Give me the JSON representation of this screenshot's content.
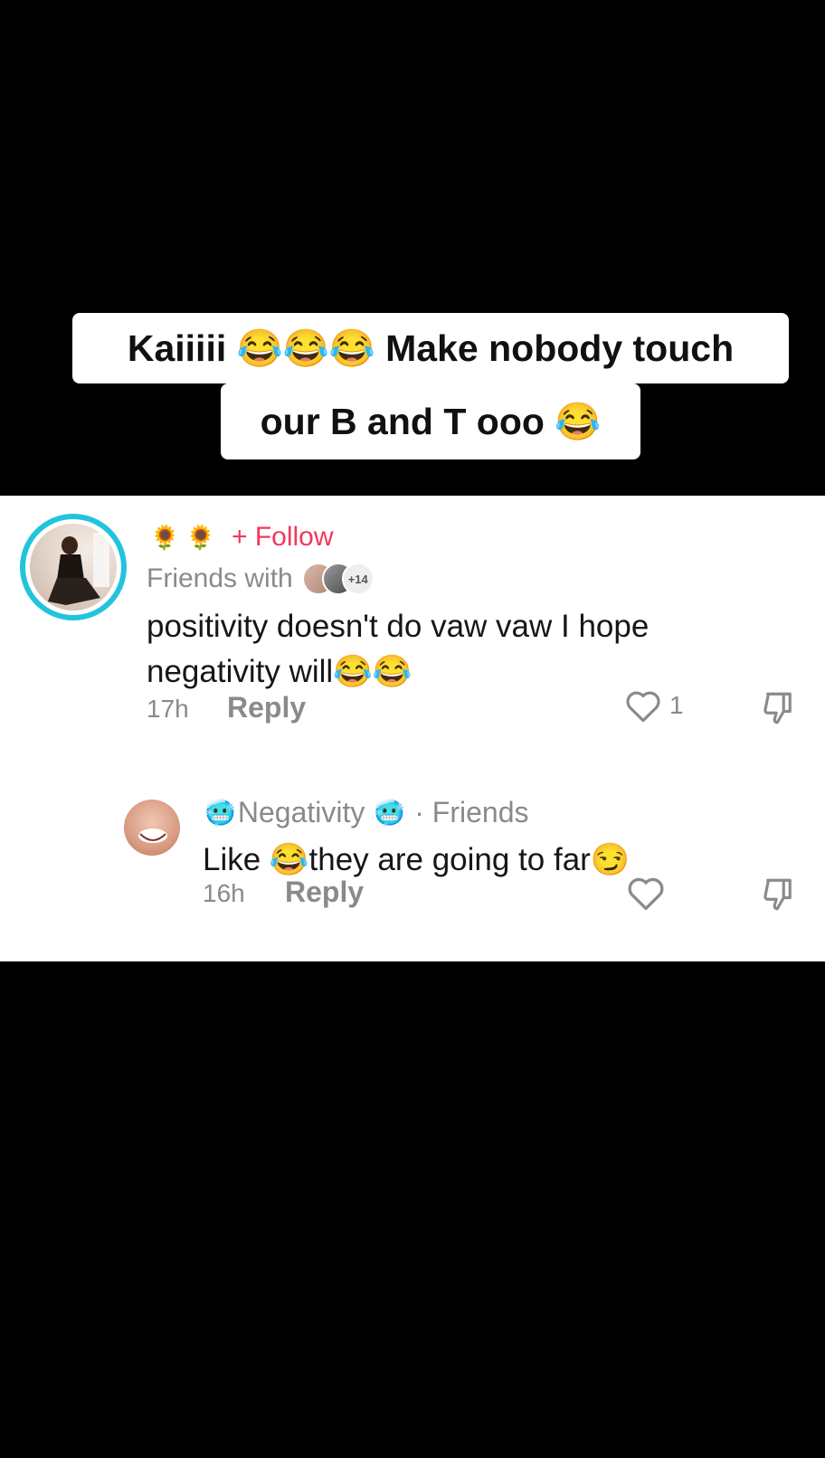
{
  "caption": {
    "line1": "Kaiiiii 😂😂😂 Make nobody touch",
    "line2": "our B and T ooo 😂"
  },
  "comment": {
    "username_emojis": "🌻 🌻",
    "follow_label": "+ Follow",
    "friends_label": "Friends with",
    "friends_more": "+14",
    "text": "positivity doesn't do vaw vaw I hope negativity will😂😂",
    "time": "17h",
    "reply_label": "Reply",
    "like_count": "1"
  },
  "reply": {
    "emoji_left": "🥶",
    "username": "Negativity",
    "emoji_right": "🥶",
    "relation": "· Friends",
    "text": "Like 😂they are going to far😏",
    "time": "16h",
    "reply_label": "Reply"
  },
  "colors": {
    "accent_follow": "#f2375d",
    "story_ring": "#22c4dc",
    "muted_text": "#8a8a8a"
  },
  "icons": [
    "heart-icon",
    "dislike-icon",
    "sunflower-icon"
  ]
}
